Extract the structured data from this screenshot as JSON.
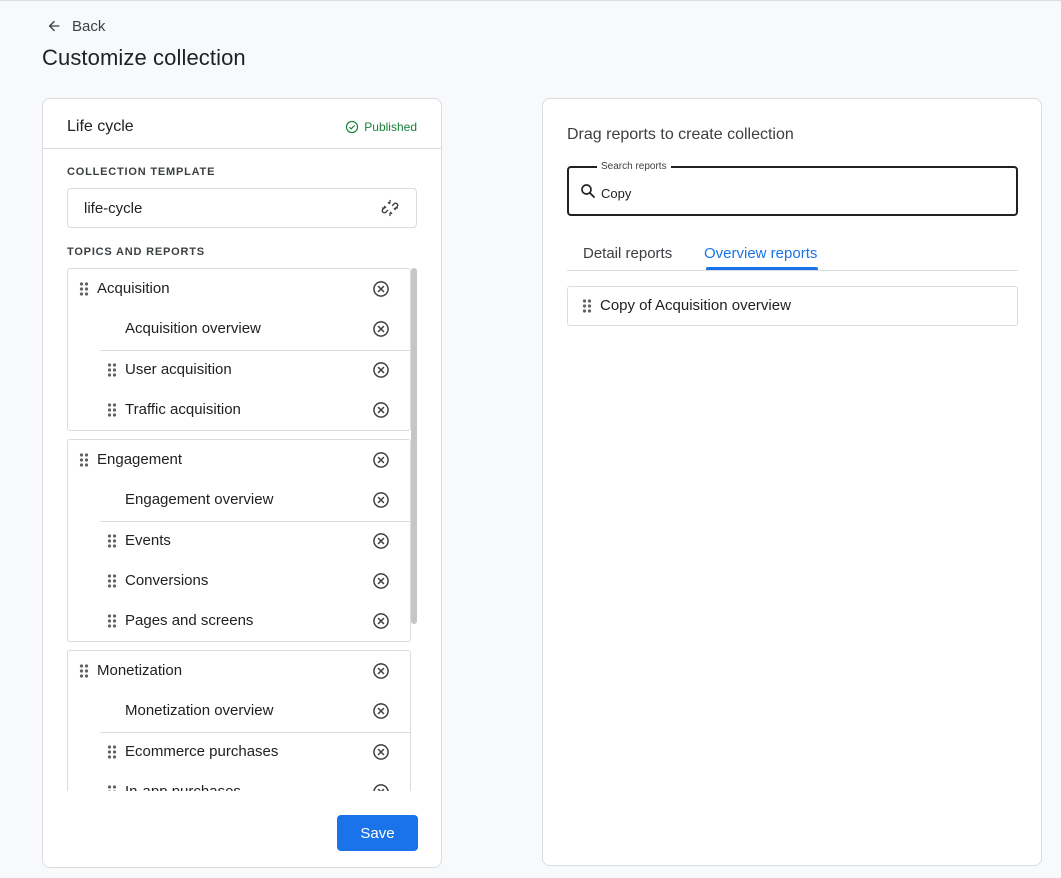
{
  "header": {
    "back_label": "Back",
    "page_title": "Customize collection"
  },
  "left_panel": {
    "collection_name": "Life cycle",
    "status": "Published",
    "template_label": "COLLECTION TEMPLATE",
    "template_value": "life-cycle",
    "topics_label": "TOPICS AND REPORTS",
    "topics": [
      {
        "name": "Acquisition",
        "reports": [
          "Acquisition overview",
          "User acquisition",
          "Traffic acquisition"
        ]
      },
      {
        "name": "Engagement",
        "reports": [
          "Engagement overview",
          "Events",
          "Conversions",
          "Pages and screens"
        ]
      },
      {
        "name": "Monetization",
        "reports": [
          "Monetization overview",
          "Ecommerce purchases",
          "In-app purchases"
        ]
      }
    ],
    "save_label": "Save"
  },
  "right_panel": {
    "title": "Drag reports to create collection",
    "search": {
      "label": "Search reports",
      "value": "Copy"
    },
    "tabs": [
      "Detail reports",
      "Overview reports"
    ],
    "active_tab": "Overview reports",
    "results": [
      "Copy of Acquisition overview"
    ]
  },
  "colors": {
    "accent": "#1a73e8",
    "published_green": "#188038",
    "border": "#dadce0"
  }
}
